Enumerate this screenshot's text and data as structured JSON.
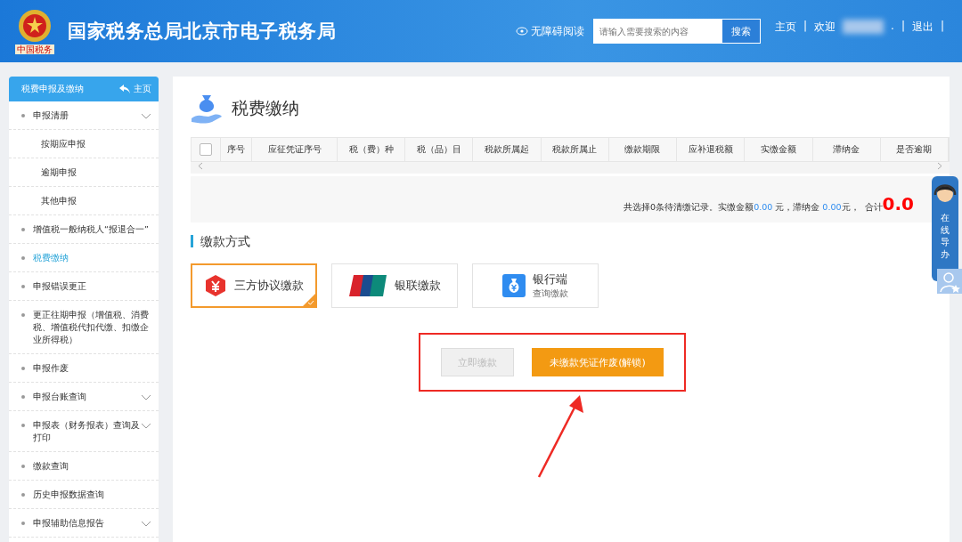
{
  "header": {
    "site_title": "国家税务总局北京市电子税务局",
    "emblem_caption": "中国税务",
    "accessibility": "无障碍阅读",
    "search": {
      "placeholder": "请输入需要搜索的内容",
      "button": "搜索"
    },
    "links": [
      {
        "kind": "link",
        "text": "主页"
      },
      {
        "kind": "sep",
        "text": "|"
      },
      {
        "kind": "link",
        "text": "欢迎"
      },
      {
        "kind": "blur"
      },
      {
        "kind": "sep",
        "text": "."
      },
      {
        "kind": "sep",
        "text": "|"
      },
      {
        "kind": "link",
        "text": "退出"
      },
      {
        "kind": "sep",
        "text": "|"
      }
    ]
  },
  "sidebar": {
    "title": "税费申报及缴纳",
    "home": "主页",
    "items": [
      {
        "kind": "group",
        "label": "申报清册",
        "selected": false,
        "has_children": true
      },
      {
        "kind": "sub",
        "label": "按期应申报",
        "selected": false
      },
      {
        "kind": "sub",
        "label": "逾期申报",
        "selected": false
      },
      {
        "kind": "sub",
        "label": "其他申报",
        "selected": false
      },
      {
        "kind": "group",
        "label": "增值税一般纳税人“报退合一”",
        "selected": false,
        "has_children": false
      },
      {
        "kind": "group",
        "label": "税费缴纳",
        "selected": true,
        "has_children": false
      },
      {
        "kind": "group",
        "label": "申报错误更正",
        "selected": false,
        "has_children": false
      },
      {
        "kind": "group",
        "label": "更正往期申报（增值税、消费税、增值税代扣代缴、扣缴企业所得税）",
        "selected": false,
        "has_children": false
      },
      {
        "kind": "group",
        "label": "申报作废",
        "selected": false,
        "has_children": false
      },
      {
        "kind": "group",
        "label": "申报台账查询",
        "selected": false,
        "has_children": true
      },
      {
        "kind": "group",
        "label": "申报表（财务报表）查询及打印",
        "selected": false,
        "has_children": true
      },
      {
        "kind": "group",
        "label": "缴款查询",
        "selected": false,
        "has_children": false
      },
      {
        "kind": "group",
        "label": "历史申报数据查询",
        "selected": false,
        "has_children": false
      },
      {
        "kind": "group",
        "label": "申报辅助信息报告",
        "selected": false,
        "has_children": true
      }
    ]
  },
  "page_title": "税费缴纳",
  "table": {
    "select_all": {
      "checked": false
    },
    "columns": [
      "序号",
      "应征凭证序号",
      "税（费）种",
      "税（品）目",
      "税款所属起",
      "税款所属止",
      "缴款期限",
      "应补退税额",
      "实缴金额",
      "滞纳金",
      "是否逾期"
    ]
  },
  "summary": {
    "prefix": "共选择0条待清缴记录。实缴金额",
    "paid": "0.00",
    "paid_unit": " 元，滞纳金 ",
    "late_fee": "0.00",
    "late_unit": "元，",
    "total_label": "合计",
    "total": "0.0"
  },
  "payment_section": "缴款方式",
  "payment_methods": [
    {
      "kind": "tripartite",
      "label": "三方协议缴款",
      "selected": true
    },
    {
      "kind": "unionpay",
      "label": "银联缴款",
      "selected": false
    },
    {
      "kind": "bank",
      "label": "银行端",
      "sublabel": "查询缴款",
      "selected": false
    }
  ],
  "actions": [
    {
      "label": "立即缴款",
      "disabled": true
    },
    {
      "label": "未缴款凭证作废(解锁)",
      "disabled": false
    }
  ],
  "online_guide": "在线导办"
}
